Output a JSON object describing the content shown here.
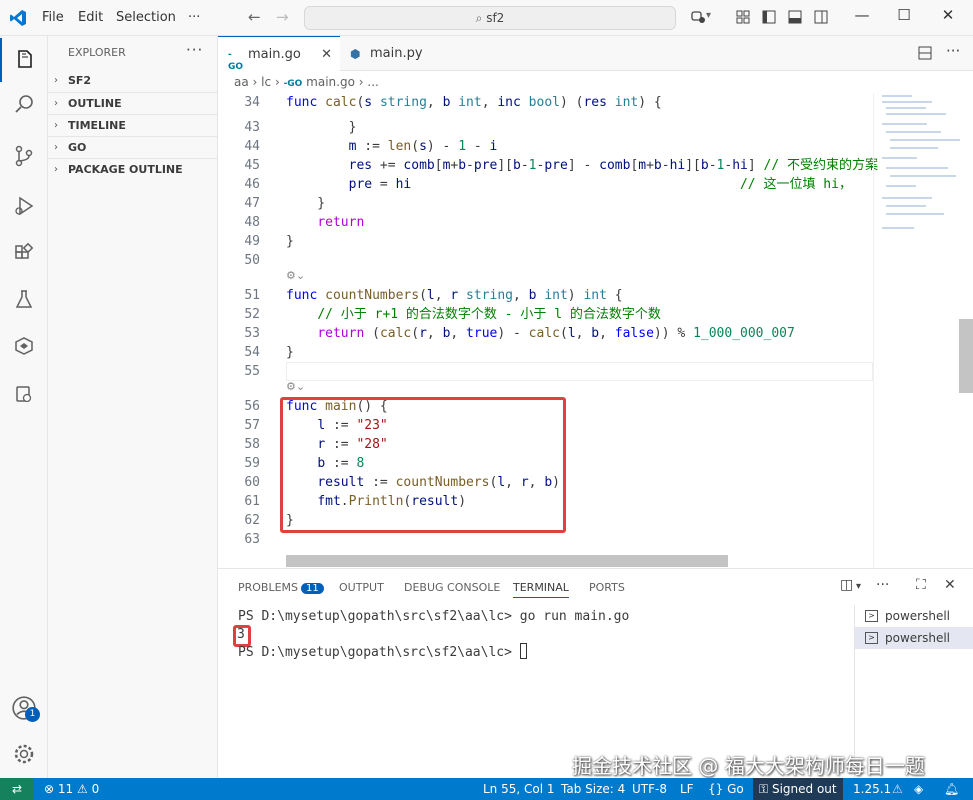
{
  "titlebar": {
    "menus": [
      "File",
      "Edit",
      "Selection"
    ],
    "more": "···",
    "search": "sf2"
  },
  "activity": {
    "account_badge": "1"
  },
  "sidebar": {
    "title": "EXPLORER",
    "more": "···",
    "sections": [
      "SF2",
      "OUTLINE",
      "TIMELINE",
      "GO",
      "PACKAGE OUTLINE"
    ]
  },
  "tabs": [
    {
      "label": "main.go",
      "icon": "go-icon",
      "active": true
    },
    {
      "label": "main.py",
      "icon": "python-icon",
      "active": false
    }
  ],
  "breadcrumb": {
    "parts": [
      "aa",
      "lc",
      "main.go",
      "..."
    ]
  },
  "code": [
    {
      "n": "34",
      "t": "func calc(s string, b int, inc bool) (res int) {"
    },
    {
      "n": "43",
      "t": "        }"
    },
    {
      "n": "44",
      "t": "        m := len(s) - 1 - i"
    },
    {
      "n": "45",
      "t": "        res += comb[m+b-pre][b-1-pre] - comb[m+b-hi][b-1-hi] // 不受约束的方案"
    },
    {
      "n": "46",
      "t": "        pre = hi                                          // 这一位填 hi，"
    },
    {
      "n": "47",
      "t": "    }"
    },
    {
      "n": "48",
      "t": "    return"
    },
    {
      "n": "49",
      "t": "}"
    },
    {
      "n": "50",
      "t": ""
    },
    {
      "n": "51",
      "t": "func countNumbers(l, r string, b int) int {"
    },
    {
      "n": "52",
      "t": "    // 小于 r+1 的合法数字个数 - 小于 l 的合法数字个数"
    },
    {
      "n": "53",
      "t": "    return (calc(r, b, true) - calc(l, b, false)) % 1_000_000_007"
    },
    {
      "n": "54",
      "t": "}"
    },
    {
      "n": "55",
      "t": ""
    },
    {
      "n": "56",
      "t": "func main() {"
    },
    {
      "n": "57",
      "t": "    l := \"23\""
    },
    {
      "n": "58",
      "t": "    r := \"28\""
    },
    {
      "n": "59",
      "t": "    b := 8"
    },
    {
      "n": "60",
      "t": "    result := countNumbers(l, r, b)"
    },
    {
      "n": "61",
      "t": "    fmt.Println(result)"
    },
    {
      "n": "62",
      "t": "}"
    },
    {
      "n": "63",
      "t": ""
    }
  ],
  "panel": {
    "tabs": [
      "PROBLEMS",
      "OUTPUT",
      "DEBUG CONSOLE",
      "TERMINAL",
      "PORTS"
    ],
    "problems_count": "11",
    "active_tab": "TERMINAL",
    "terminal": {
      "prompt1": "PS D:\\mysetup\\gopath\\src\\sf2\\aa\\lc> ",
      "command": "go run main.go",
      "output": "3",
      "prompt2": "PS D:\\mysetup\\gopath\\src\\sf2\\aa\\lc> "
    },
    "terminals": [
      "powershell",
      "powershell"
    ]
  },
  "watermark": "掘金技术社区 @ 福大大架构师每日一题",
  "statusbar": {
    "errors": "11",
    "warnings": "0",
    "position": "Ln 55, Col 1",
    "tab_size": "Tab Size: 4",
    "encoding": "UTF-8",
    "eol": "LF",
    "language": "Go",
    "account": "Signed out",
    "version": "1.25.1"
  },
  "colors": {
    "accent": "#005fb8",
    "statusbar": "#007acc",
    "highlight_box": "#e04040"
  }
}
